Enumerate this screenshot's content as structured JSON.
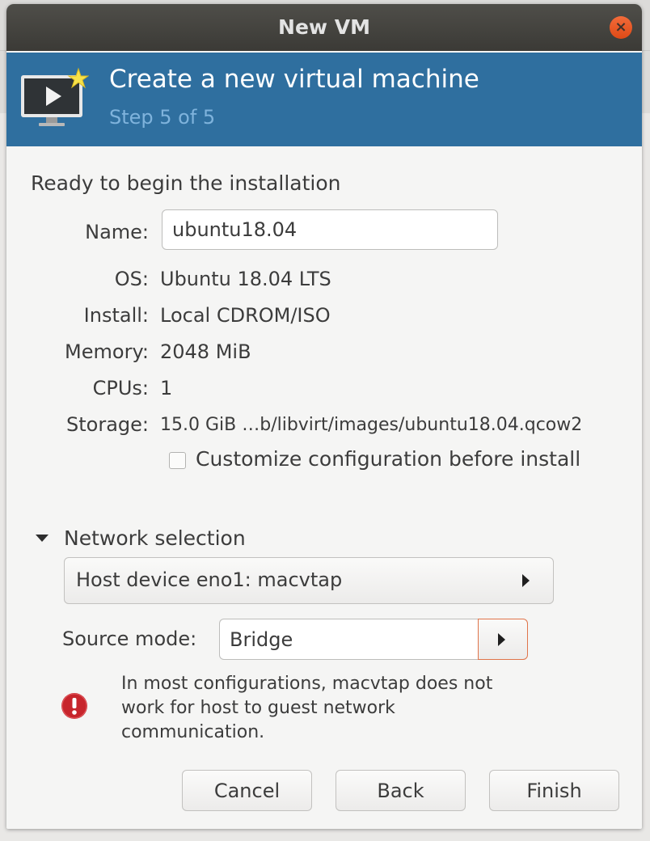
{
  "window": {
    "title": "New VM"
  },
  "header": {
    "title": "Create a new virtual machine",
    "step": "Step 5 of 5"
  },
  "summary": {
    "heading": "Ready to begin the installation",
    "name_label": "Name:",
    "name_value": "ubuntu18.04",
    "os_label": "OS:",
    "os_value": "Ubuntu 18.04 LTS",
    "install_label": "Install:",
    "install_value": "Local CDROM/ISO",
    "memory_label": "Memory:",
    "memory_value": "2048 MiB",
    "cpus_label": "CPUs:",
    "cpus_value": "1",
    "storage_label": "Storage:",
    "storage_value": "15.0 GiB …b/libvirt/images/ubuntu18.04.qcow2",
    "customize_label": "Customize configuration before install",
    "customize_checked": false
  },
  "network": {
    "expander_label": "Network selection",
    "device_value": "Host device eno1: macvtap",
    "source_mode_label": "Source mode:",
    "source_mode_value": "Bridge",
    "warning_text": "In most configurations, macvtap does not work for host to guest network communication."
  },
  "buttons": {
    "cancel": "Cancel",
    "back": "Back",
    "finish": "Finish"
  },
  "icons": {
    "close": "close-icon",
    "header": "monitor-play-icon",
    "warning": "error-icon"
  },
  "colors": {
    "titlebar": "#3b3a36",
    "header_bg": "#2f6f9f",
    "close_button": "#e55a25",
    "warning": "#c7252c"
  }
}
